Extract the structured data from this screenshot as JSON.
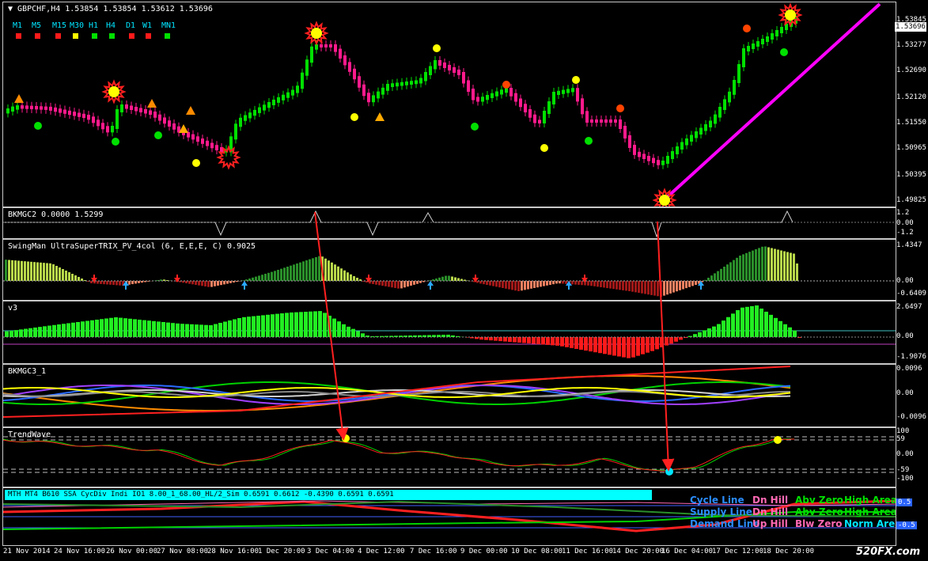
{
  "chart": {
    "title": "GBPCHF,H4  1.53854 1.53854 1.53612 1.53696",
    "current_price": "1.53696",
    "price_scale": [
      "1.53845",
      "1.53277",
      "1.52690",
      "1.52120",
      "1.51550",
      "1.50965",
      "1.50395",
      "1.49825"
    ]
  },
  "timeframes": [
    {
      "label": "M1",
      "color": "#ff1a1a"
    },
    {
      "label": "M5",
      "color": "#ff1a1a"
    },
    {
      "label": "M15",
      "color": "#ff1a1a"
    },
    {
      "label": "M30",
      "color": "#ffff00"
    },
    {
      "label": "H1",
      "color": "#00e000"
    },
    {
      "label": "H4",
      "color": "#00e000"
    },
    {
      "label": "D1",
      "color": "#ff1a1a"
    },
    {
      "label": "W1",
      "color": "#ff1a1a"
    },
    {
      "label": "MN1",
      "color": "#00e000"
    }
  ],
  "indicators": {
    "bkmgc2": {
      "title": "BKMGC2 0.0000 1.5299",
      "scale": [
        "1.2",
        "0.00",
        "-1.2"
      ]
    },
    "swingman": {
      "title": "SwingMan UltraSuperTRIX_PV_4col (6, E,E,E, C) 0.9025",
      "scale": [
        "1.4347",
        "0.00",
        "-0.6409"
      ]
    },
    "v3": {
      "title": "v3",
      "scale": [
        "2.6497",
        "0.00",
        "-1.9076"
      ]
    },
    "bkmgc3": {
      "title": "BKMGC3_1",
      "scale": [
        "0.0096",
        "0.00",
        "-0.0096"
      ]
    },
    "trendwave": {
      "title": "TrendWave",
      "scale": [
        "100",
        "59",
        "0.00",
        "-59",
        "-100"
      ]
    },
    "mth": {
      "title": "MTH MT4 B610 SSA CycDiv Indi IO1 8.00_1_68.00_HL/2_Sim 0.6591 0.6612 -0.4390 0.6591 0.6591",
      "scale": [
        "0.5",
        "-0.5"
      ]
    }
  },
  "legend": [
    {
      "a": "Cycle Line",
      "b": "Dn Hill",
      "c": "Abv Zero",
      "d": "High Area"
    },
    {
      "a": "Supply Line",
      "b": "Dn Hill",
      "c": "Abv Zero",
      "d": "High Area"
    },
    {
      "a": "Demand Line",
      "b": "Up Hill",
      "c": "Blw Zero",
      "d": "Norm Area"
    }
  ],
  "time_axis": [
    "21 Nov 2014",
    "24 Nov 16:00",
    "26 Nov 00:00",
    "27 Nov 08:00",
    "28 Nov 16:00",
    "1 Dec 20:00",
    "3 Dec 04:00",
    "4 Dec 12:00",
    "7 Dec 16:00",
    "9 Dec 00:00",
    "10 Dec 08:00",
    "11 Dec 16:00",
    "14 Dec 20:00",
    "16 Dec 04:00",
    "17 Dec 12:00",
    "18 Dec 20:00"
  ],
  "watermark": "520FX.com"
}
